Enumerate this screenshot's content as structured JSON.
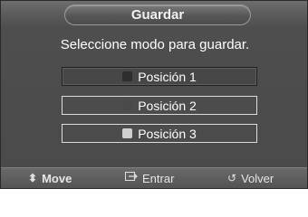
{
  "dialog": {
    "title": "Guardar",
    "prompt": "Seleccione modo para guardar."
  },
  "options": [
    {
      "label": "Posición 1",
      "swatch_color": "#2e2e2e",
      "selected": true
    },
    {
      "label": "Posición 2",
      "swatch_color": "#4a4a4a",
      "selected": false
    },
    {
      "label": "Posición 3",
      "swatch_color": "#cfcfcf",
      "selected": false
    }
  ],
  "footer": {
    "move": {
      "label": "Move",
      "icon": "up-down-arrows-icon"
    },
    "enter": {
      "label": "Entrar",
      "icon": "enter-icon"
    },
    "return": {
      "label": "Volver",
      "icon": "return-icon"
    }
  }
}
